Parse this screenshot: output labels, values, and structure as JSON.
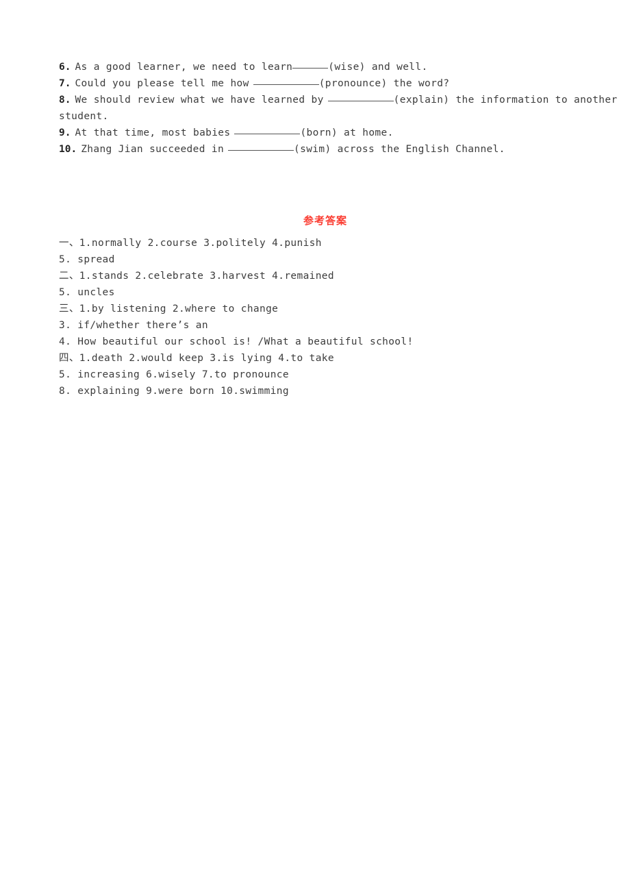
{
  "document": {
    "page_background": "#ffffff",
    "text_color": "#3c3c3c",
    "accent_color": "#fb3b30"
  },
  "questions": [
    {
      "number": "6.",
      "before": "As a good learner, we need to learn",
      "blank": "short",
      "after": "(wise) and well.",
      "space_before_blank": false,
      "space_after_blank": false
    },
    {
      "number": "7.",
      "before": "Could you please tell me how",
      "blank": "long",
      "after": "(pronounce) the word?",
      "space_before_blank": true,
      "space_after_blank": false
    },
    {
      "number": "8.",
      "before": "We should review what we have learned by",
      "blank": "long",
      "after": "(explain) the information to another",
      "continuation": "student.",
      "space_before_blank": true,
      "space_after_blank": false
    },
    {
      "number": "9.",
      "before": "At that time, most babies",
      "blank": "long",
      "after": "(born) at home.",
      "space_before_blank": true,
      "space_after_blank": false
    },
    {
      "number": "10.",
      "before": "Zhang Jian succeeded in",
      "blank": "long",
      "after": "(swim) across the English Channel.",
      "space_before_blank": true,
      "space_after_blank": false
    }
  ],
  "answer_key": {
    "heading": "参考答案",
    "lines": [
      "一、1.normally  2.course  3.politely  4.punish",
      "5. spread",
      "二、1.stands  2.celebrate  3.harvest  4.remained",
      "5. uncles",
      "三、1.by listening  2.where to change",
      "3. if/whether there’s an",
      "4. How beautiful our school is! /What a beautiful school!",
      "四、1.death  2.would keep  3.is lying  4.to take",
      "5. increasing  6.wisely  7.to pronounce",
      "8. explaining  9.were born  10.swimming"
    ]
  }
}
